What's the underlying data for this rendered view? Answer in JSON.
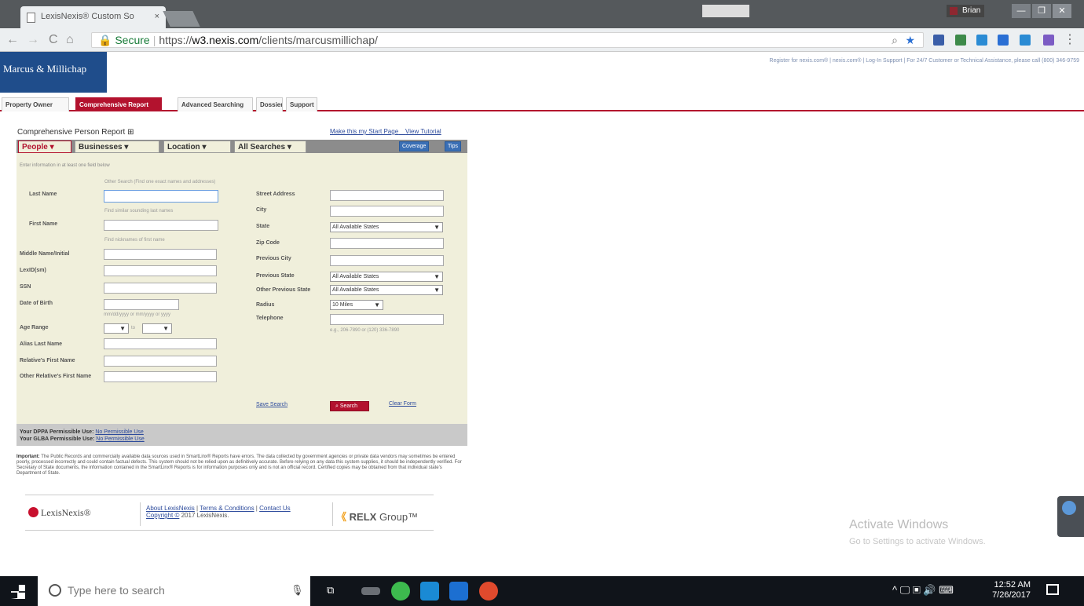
{
  "browser": {
    "tab_title": "LexisNexis® Custom So",
    "tab_close": "×",
    "url_secure_label": "Secure",
    "url_scheme": "https://",
    "url_host": "w3.nexis.com",
    "url_path": "/clients/marcusmillichap/",
    "ime_label": "",
    "user_name": "Brian",
    "win_min": "—",
    "win_max": "❐",
    "win_close": "✕"
  },
  "site": {
    "logo_text": "Marcus & Millichap",
    "top_links": "Register for nexis.com® | nexis.com® | Log-In Support | For 24/7 Customer or Technical Assistance, please call (800) 346-9759",
    "nav_tabs": [
      "Property Owner",
      "Comprehensive Report",
      "Advanced Searching",
      "Dossier",
      "Support"
    ]
  },
  "report": {
    "title": "Comprehensive Person Report",
    "title_icon": "⊞",
    "link_start_page": "Make this my Start Page",
    "link_tutorial": "View Tutorial",
    "tabs": [
      "People ▾",
      "Businesses ▾",
      "Location ▾",
      "All Searches ▾"
    ],
    "btn_coverage": "Coverage",
    "btn_tips": "Tips",
    "form_note": "Enter information in at least one field below",
    "left_fields": [
      "Last Name",
      "First Name",
      "Middle Name/Initial",
      "LexID(sm)",
      "SSN",
      "Date of Birth",
      "Age Range",
      "Alias Last Name",
      "Relative's First Name",
      "Other Relative's First Name"
    ],
    "right_fields": [
      "Street Address",
      "City",
      "State",
      "Zip Code",
      "Previous City",
      "Previous State",
      "Other Previous State",
      "Radius",
      "Telephone"
    ],
    "check_other_search": "Other Search (Find one exact names and addresses)",
    "check_similar_names": "Find similar sounding last names",
    "check_nicknames": "Find nicknames of first name",
    "dob_hint": "mm/dd/yyyy or mm/yyyy or yyyy",
    "age_to": "to",
    "phone_hint": "e.g., 206-7890 or (120) 336-7890",
    "select_states": "All Available States",
    "select_radius": "10 Miles",
    "link_save_search": "Save Search",
    "btn_search": "Search",
    "link_clear_form": "Clear Form"
  },
  "permissions": {
    "dppa_label": "Your DPPA Permissible Use:",
    "dppa_value": "No Permissible Use",
    "glba_label": "Your GLBA Permissible Use:",
    "glba_value": "No Permissible Use"
  },
  "disclaimer": {
    "heading": "Important:",
    "text": "The Public Records and commercially available data sources used in SmartLinx® Reports have errors. The data collected by government agencies or private data vendors may sometimes be entered poorly, processed incorrectly and could contain factual defects. This system should not be relied upon as definitively accurate. Before relying on any data this system supplies, it should be independently verified. For Secretary of State documents, the information contained in the SmartLinx® Reports is for information purposes only and is not an official record. Certified copies may be obtained from that individual state's Department of State."
  },
  "footer": {
    "lexis_logo": "LexisNexis®",
    "about": "About LexisNexis",
    "terms": "Terms & Conditions",
    "contact": "Contact Us",
    "copyright_link": "Copyright ©",
    "copyright_text": "2017 LexisNexis.",
    "relx_mark": "《",
    "relx_text": "RELX",
    "relx_group": "Group™"
  },
  "activation": {
    "line1": "Activate Windows",
    "line2": "Go to Settings to activate Windows."
  },
  "taskbar": {
    "search_placeholder": "Type here to search",
    "mic": "🎙",
    "time": "12:52 AM",
    "date": "7/26/2017",
    "tray": "^ 🖵 ▣ 🔊 ⌨"
  },
  "colors": {
    "brand_red": "#b3122e",
    "brand_blue": "#1f4d8b",
    "form_bg": "#f0efdb",
    "link": "#2d4b9c"
  }
}
